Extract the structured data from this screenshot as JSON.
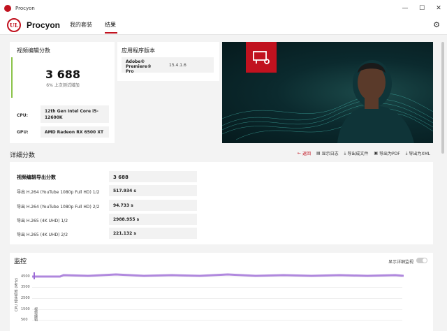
{
  "window": {
    "title": "Procyon",
    "minimize": "—",
    "maximize": "☐",
    "close": "✕"
  },
  "header": {
    "logo": "UL",
    "brand": "Procyon",
    "tabs": [
      {
        "label": "我的套装"
      },
      {
        "label": "结果"
      }
    ],
    "active_tab": "结果"
  },
  "score_card": {
    "title": "视频编辑分数",
    "score": "3 688",
    "subtitle": "6% 上次测试增加",
    "cpu_label": "CPU:",
    "cpu_value": "12th Gen Intel Core i5-12600K",
    "gpu_label": "GPU:",
    "gpu_value": "AMD Radeon RX 6500 XT"
  },
  "version_card": {
    "title": "应用程序版本",
    "app_name": "Adobe® Premiere® Pro",
    "version": "15.4.1.6"
  },
  "detail": {
    "title": "详细分数",
    "actions": [
      {
        "label": "返回",
        "icon": "back-arrow-icon"
      },
      {
        "label": "显示日志",
        "icon": "doc-icon"
      },
      {
        "label": "导出成文件",
        "icon": "download-icon"
      },
      {
        "label": "导出为PDF",
        "icon": "save-icon"
      },
      {
        "label": "导出为XML",
        "icon": "download-icon"
      }
    ],
    "rows": [
      {
        "label": "视频编辑导出分数",
        "value": "3 688"
      },
      {
        "label": "导出 H.264 (YouTube 1080p Full HD) 1/2",
        "value": "517.934 s"
      },
      {
        "label": "导出 H.264 (YouTube 1080p Full HD) 2/2",
        "value": "94.733 s"
      },
      {
        "label": "导出 H.265 (4K UHD) 1/2",
        "value": "2988.955 s"
      },
      {
        "label": "导出 H.265 (4K UHD) 2/2",
        "value": "221.132 s"
      }
    ]
  },
  "monitor": {
    "title": "监控",
    "toggle_label": "显示详细监视",
    "y_axis_title": "CPU 时钟频率 (MHz)",
    "y_ticks": [
      "4500",
      "3500",
      "2500",
      "1500",
      "500"
    ],
    "side_label": "视频编辑"
  },
  "colors": {
    "accent": "#c1121f",
    "score_bar": "#8bc34a",
    "monitor_line": "#9c6ad6"
  }
}
